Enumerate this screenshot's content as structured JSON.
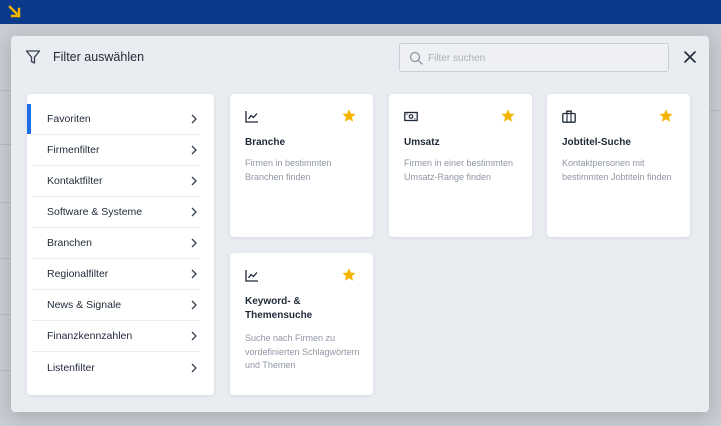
{
  "modal": {
    "title": "Filter auswählen",
    "search_placeholder": "Filter suchen",
    "search_value": ""
  },
  "sidebar": {
    "items": [
      {
        "label": "Favoriten",
        "active": true
      },
      {
        "label": "Firmenfilter"
      },
      {
        "label": "Kontaktfilter"
      },
      {
        "label": "Software & Systeme"
      },
      {
        "label": "Branchen"
      },
      {
        "label": "Regionalfilter"
      },
      {
        "label": "News & Signale"
      },
      {
        "label": "Finanzkennzahlen"
      },
      {
        "label": "Listenfilter"
      }
    ]
  },
  "cards": [
    {
      "title": "Branche",
      "description": "Firmen in bestimmten Branchen finden",
      "icon": "chart-icon",
      "favorite": true
    },
    {
      "title": "Umsatz",
      "description": "Firmen in einer bestimmten Umsatz-Range finden",
      "icon": "money-icon",
      "favorite": true
    },
    {
      "title": "Jobtitel-Suche",
      "description": "Kontaktpersonen mit bestimmten Jobtiteln finden",
      "icon": "briefcase-icon",
      "favorite": true
    },
    {
      "title": "Keyword- & Themensuche",
      "description": "Suche nach Firmen zu vordefinierten Schlagwörtern und Themen",
      "icon": "chart-icon",
      "favorite": true
    }
  ],
  "colors": {
    "topbar": "#0b3a8a",
    "accent": "#1e6fe6",
    "star": "#f5b400"
  }
}
